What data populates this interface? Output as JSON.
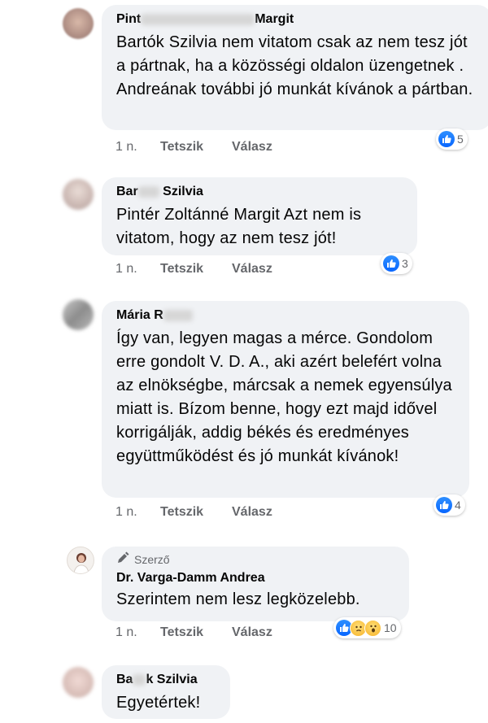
{
  "comments": [
    {
      "name_visible_start": "Pint",
      "name_visible_end": "Margit",
      "text": "Bartók Szilvia nem vitatom csak az nem tesz jót a pártnak, ha a közösségi oldalon üzengetnek . Andreának további jó munkát kívánok a pártban.",
      "time": "1 n.",
      "like_label": "Tetszik",
      "reply_label": "Válasz",
      "reactions": "5"
    },
    {
      "name_visible_start": "Bar",
      "name_visible_end": "Szilvia",
      "text": "Pintér Zoltánné Margit Azt nem is vitatom, hogy az nem tesz jót!",
      "time": "1 n.",
      "like_label": "Tetszik",
      "reply_label": "Válasz",
      "reactions": "3"
    },
    {
      "name_visible_start": "Mária R",
      "name_visible_end": "",
      "text": "Így van, legyen magas a mérce. Gondolom erre gondolt V. D. A., aki azért belefért volna az elnökségbe, márcsak a nemek egyensúlya miatt is. Bízom benne, hogy ezt majd idővel korrigálják, addig békés és eredményes együttműködést és jó munkát kívánok!",
      "time": "1 n.",
      "like_label": "Tetszik",
      "reply_label": "Válasz",
      "reactions": "4"
    },
    {
      "author_tag": "Szerző",
      "name": "Dr. Varga-Damm Andrea",
      "text": "Szerintem nem lesz legközelebb.",
      "time": "1 n.",
      "like_label": "Tetszik",
      "reply_label": "Válasz",
      "reactions": "10"
    },
    {
      "name_visible_start": "Ba",
      "name_visible_end": "k Szilvia",
      "text": "Egyetértek!"
    }
  ],
  "icons": {
    "like": "like-icon",
    "sad": "sad-icon",
    "wow": "wow-icon",
    "pen": "pen-icon"
  },
  "colors": {
    "like_blue": "#0866ff",
    "bubble": "#f0f2f5",
    "meta": "#65676b"
  }
}
